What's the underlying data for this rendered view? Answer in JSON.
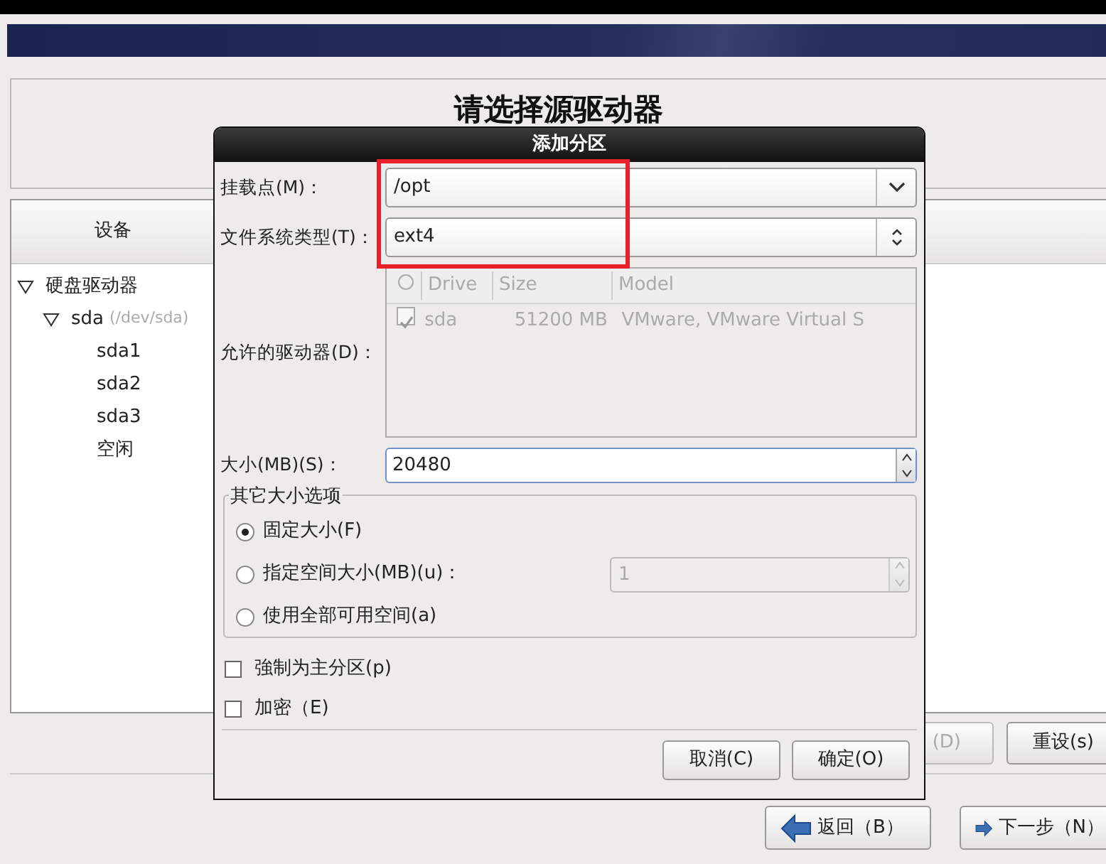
{
  "page": {
    "title": "请选择源驱动器"
  },
  "device_tree": {
    "header": "设备",
    "items": [
      {
        "label": "硬盘驱动器",
        "expanded": true,
        "children": [
          {
            "label": "sda",
            "note": "(/dev/sda)",
            "expanded": true,
            "children": [
              {
                "label": "sda1"
              },
              {
                "label": "sda2"
              },
              {
                "label": "sda3"
              },
              {
                "label": "空闲"
              }
            ]
          }
        ]
      }
    ]
  },
  "action_buttons": [
    {
      "label": "(D)",
      "disabled": true
    },
    {
      "label": "重设(s)",
      "disabled": false
    }
  ],
  "nav_buttons": [
    {
      "label": "返回（B）",
      "kind": "back"
    },
    {
      "label": "下一步（N）",
      "kind": "next"
    }
  ],
  "dialog": {
    "title": "添加分区",
    "mount_point": {
      "label": "挂载点(M)：",
      "value": "/opt"
    },
    "fs_type": {
      "label": "文件系统类型(T)：",
      "value": "ext4"
    },
    "drives": {
      "label": "允许的驱动器(D)：",
      "disabled": true,
      "columns": [
        "Drive",
        "Size",
        "Model"
      ],
      "rows": [
        {
          "checked": true,
          "drive": "sda",
          "size": "51200 MB",
          "model": "VMware, VMware Virtual S"
        }
      ]
    },
    "size": {
      "label": "大小(MB)(S)：",
      "value": "20480"
    },
    "size_options": {
      "title": "其它大小选项",
      "options": [
        {
          "label": "固定大小(F)",
          "selected": true
        },
        {
          "label": "指定空间大小(MB)(u)：",
          "selected": false,
          "field": {
            "value": "1",
            "disabled": true
          }
        },
        {
          "label": "使用全部可用空间(a)",
          "selected": false
        }
      ]
    },
    "checkboxes": [
      {
        "label": "強制为主分区(p)",
        "checked": false
      },
      {
        "label": "加密（E)",
        "checked": false
      }
    ],
    "buttons": [
      {
        "label": "取消(C)"
      },
      {
        "label": "确定(O)"
      }
    ]
  }
}
